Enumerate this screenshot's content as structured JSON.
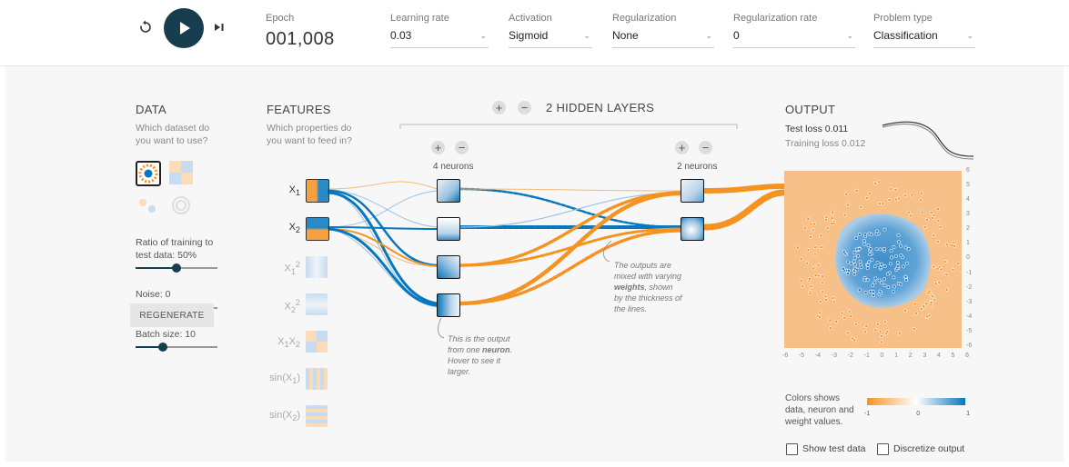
{
  "top": {
    "epoch_label": "Epoch",
    "epoch_value": "001,008",
    "learning_rate": {
      "label": "Learning rate",
      "value": "0.03"
    },
    "activation": {
      "label": "Activation",
      "value": "Sigmoid"
    },
    "regularization": {
      "label": "Regularization",
      "value": "None"
    },
    "regularization_rate": {
      "label": "Regularization rate",
      "value": "0"
    },
    "problem_type": {
      "label": "Problem type",
      "value": "Classification"
    }
  },
  "data_panel": {
    "title": "DATA",
    "subtitle_1": "Which dataset do",
    "subtitle_2": "you want to use?",
    "ratio_label_1": "Ratio of training to",
    "ratio_label_2": "test data: 50%",
    "noise_label": "Noise: 0",
    "batch_label": "Batch size: 10",
    "regenerate": "REGENERATE",
    "ratio_fraction": 0.5,
    "noise_fraction": 0.0,
    "batch_fraction": 0.33
  },
  "features_panel": {
    "title": "FEATURES",
    "subtitle_1": "Which properties do",
    "subtitle_2": "you want to feed in?",
    "labels": [
      "X",
      "X",
      "X",
      "X",
      "X",
      "sin(X",
      "sin(X"
    ],
    "subs": [
      "1",
      "2",
      "1",
      "2",
      "1",
      "1",
      "2"
    ],
    "sups": [
      "",
      "",
      "2",
      "2",
      "",
      "",
      ""
    ],
    "x1x2_second": "X",
    "x1x2_second_sub": "2",
    "close_paren": ")"
  },
  "hidden": {
    "title": "2 HIDDEN LAYERS",
    "layer1_label": "4 neurons",
    "layer2_label": "2 neurons",
    "plus": "+",
    "minus": "−"
  },
  "notes": {
    "neuron_note_1": "This is the output",
    "neuron_note_2": "from one",
    "neuron_note_bold": "neuron",
    "neuron_note_3": "Hover to see it",
    "neuron_note_4": "larger.",
    "weights_note_1": "The outputs are",
    "weights_note_2": "mixed with varying",
    "weights_note_bold": "weights",
    "weights_note_3": "shown",
    "weights_note_4": "by the thickness of",
    "weights_note_5": "the lines."
  },
  "output_panel": {
    "title": "OUTPUT",
    "test_loss": "Test loss 0.011",
    "training_loss": "Training loss 0.012",
    "axis_ticks": [
      "-6",
      "-5",
      "-4",
      "-3",
      "-2",
      "-1",
      "0",
      "1",
      "2",
      "3",
      "4",
      "5",
      "6"
    ],
    "y_ticks": [
      "6",
      "5",
      "4",
      "3",
      "2",
      "1",
      "0",
      "-1",
      "-2",
      "-3",
      "-4",
      "-5",
      "-6"
    ],
    "legend_text_1": "Colors shows",
    "legend_text_2": "data, neuron and",
    "legend_text_3": "weight values.",
    "legend_ticks": [
      "-1",
      "0",
      "1"
    ],
    "show_test_data": "Show test data",
    "discretize_output": "Discretize output"
  },
  "colors": {
    "orange": "#f59322",
    "blue": "#0877bd",
    "dark": "#183d4e"
  }
}
